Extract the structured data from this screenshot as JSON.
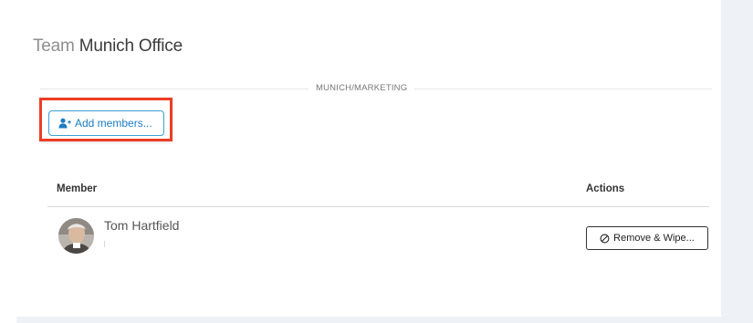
{
  "team": {
    "prefix": "Team",
    "name": "Munich Office"
  },
  "group": {
    "label": "MUNICH/MARKETING"
  },
  "actions": {
    "add_members_label": "Add members...",
    "add_members_icon": "add-user-icon",
    "highlight_color": "#ee3d24",
    "accent_color": "#1c7cc2"
  },
  "table": {
    "columns": {
      "member": "Member",
      "actions": "Actions"
    },
    "rows": [
      {
        "name": "Tom Hartfield",
        "action_label": "Remove & Wipe...",
        "action_icon": "prohibited-icon"
      }
    ]
  }
}
